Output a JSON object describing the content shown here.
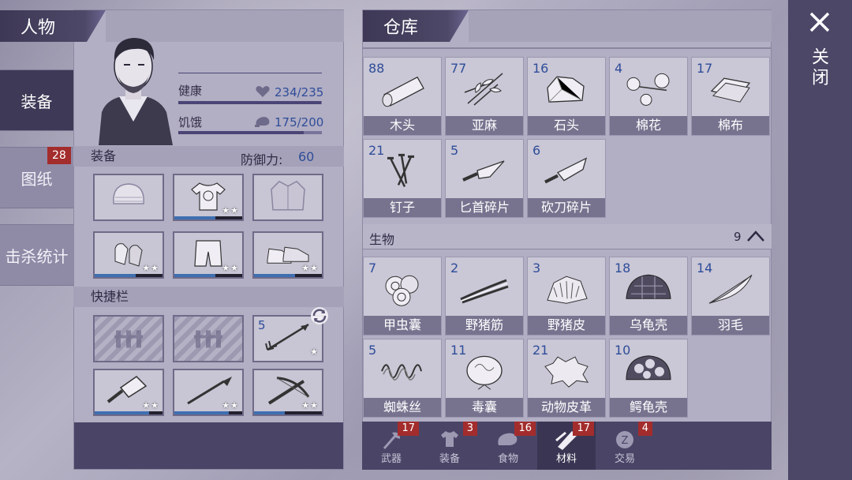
{
  "character": {
    "header": "人物",
    "health_label": "健康",
    "health_value": "234/235",
    "health_fraction": 0.996,
    "hunger_label": "饥饿",
    "hunger_value": "175/200",
    "hunger_fraction": 0.875,
    "equipment_title": "装备",
    "defense_label": "防御力:",
    "defense_value": "60",
    "quickbar_title": "快捷栏",
    "equipment": [
      {
        "icon": "hat-icon",
        "stars": "",
        "durability": null
      },
      {
        "icon": "shirt-icon",
        "stars": "★★",
        "durability": 0.6
      },
      {
        "icon": "jacket-icon",
        "stars": "",
        "durability": null
      },
      {
        "icon": "gloves-icon",
        "stars": "★★",
        "durability": 0.6
      },
      {
        "icon": "pants-icon",
        "stars": "★★",
        "durability": 0.6
      },
      {
        "icon": "shoes-icon",
        "stars": "★★",
        "durability": 0.6
      }
    ],
    "quickbar": [
      {
        "icon": "fence-icon",
        "count": "",
        "stars": ""
      },
      {
        "icon": "fence-icon",
        "count": "",
        "stars": ""
      },
      {
        "icon": "arrow-icon",
        "count": "5",
        "stars": "★"
      },
      {
        "icon": "cleaver-icon",
        "count": "",
        "stars": "★★",
        "durability": 0.8
      },
      {
        "icon": "spear-icon",
        "count": "",
        "stars": "★★",
        "durability": 0.8
      },
      {
        "icon": "crossbow-icon",
        "count": "",
        "stars": "★★",
        "durability": 0.45
      }
    ]
  },
  "sidebar": {
    "items": [
      {
        "label": "装备",
        "active": true
      },
      {
        "label": "图纸",
        "badge": "28"
      },
      {
        "label": "击杀统计"
      }
    ]
  },
  "storage": {
    "header": "仓库",
    "items": [
      {
        "count": "88",
        "name": "木头",
        "icon": "log-icon"
      },
      {
        "count": "77",
        "name": "亚麻",
        "icon": "flax-icon"
      },
      {
        "count": "16",
        "name": "石头",
        "icon": "stone-icon"
      },
      {
        "count": "4",
        "name": "棉花",
        "icon": "cotton-icon"
      },
      {
        "count": "17",
        "name": "棉布",
        "icon": "cloth-icon"
      },
      {
        "count": "21",
        "name": "钉子",
        "icon": "nails-icon"
      },
      {
        "count": "5",
        "name": "匕首碎片",
        "icon": "dagger-shard-icon"
      },
      {
        "count": "6",
        "name": "砍刀碎片",
        "icon": "machete-shard-icon"
      }
    ],
    "section_label": "生物",
    "section_count": "9",
    "creatures": [
      {
        "count": "7",
        "name": "甲虫囊",
        "icon": "beetle-sac-icon"
      },
      {
        "count": "2",
        "name": "野猪筋",
        "icon": "boar-sinew-icon"
      },
      {
        "count": "3",
        "name": "野猪皮",
        "icon": "boar-hide-icon"
      },
      {
        "count": "18",
        "name": "乌龟壳",
        "icon": "turtle-shell-icon"
      },
      {
        "count": "14",
        "name": "羽毛",
        "icon": "feather-icon"
      },
      {
        "count": "5",
        "name": "蜘蛛丝",
        "icon": "spider-silk-icon"
      },
      {
        "count": "11",
        "name": "毒囊",
        "icon": "poison-sac-icon"
      },
      {
        "count": "21",
        "name": "动物皮革",
        "icon": "leather-icon"
      },
      {
        "count": "10",
        "name": "鳄龟壳",
        "icon": "croc-shell-icon"
      }
    ],
    "tabs": [
      {
        "label": "武器",
        "badge": "17",
        "icon": "axe-icon"
      },
      {
        "label": "装备",
        "badge": "3",
        "icon": "shirt-icon"
      },
      {
        "label": "食物",
        "badge": "16",
        "icon": "meat-icon"
      },
      {
        "label": "材料",
        "badge": "17",
        "icon": "material-icon",
        "active": true
      },
      {
        "label": "交易",
        "badge": "4",
        "icon": "coin-icon"
      }
    ]
  },
  "close": {
    "label": "关闭"
  }
}
